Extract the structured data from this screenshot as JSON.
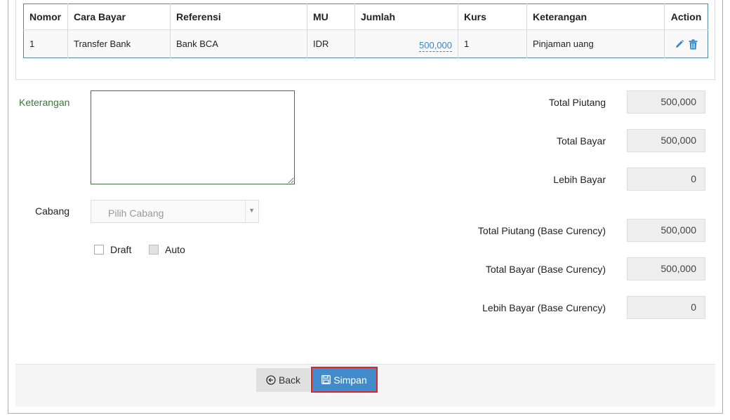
{
  "table": {
    "headers": [
      "Nomor",
      "Cara Bayar",
      "Referensi",
      "MU",
      "Jumlah",
      "Kurs",
      "Keterangan",
      "Action"
    ],
    "rows": [
      {
        "nomor": "1",
        "cara_bayar": "Transfer Bank",
        "referensi": "Bank BCA",
        "mu": "IDR",
        "jumlah": "500,000",
        "kurs": "1",
        "keterangan": "Pinjaman uang",
        "actions": [
          "edit-icon",
          "trash-icon"
        ]
      }
    ]
  },
  "form": {
    "keterangan_label": "Keterangan",
    "keterangan_value": "",
    "cabang_label": "Cabang",
    "cabang_placeholder": "Pilih Cabang",
    "draft_label": "Draft",
    "auto_label": "Auto",
    "draft_checked": false,
    "auto_checked": false
  },
  "summary": [
    {
      "label": "Total Piutang",
      "value": "500,000"
    },
    {
      "label": "Total Bayar",
      "value": "500,000"
    },
    {
      "label": "Lebih Bayar",
      "value": "0"
    },
    {
      "label": "Total Piutang (Base Curency)",
      "value": "500,000"
    },
    {
      "label": "Total Bayar (Base Curency)",
      "value": "500,000"
    },
    {
      "label": "Lebih Bayar (Base Curency)",
      "value": "0"
    }
  ],
  "buttons": {
    "back_label": "Back",
    "save_label": "Simpan"
  },
  "colors": {
    "primary": "#428bca",
    "link": "#3a87c4",
    "success_label": "#3c763d",
    "highlight_border": "#d9262c"
  }
}
